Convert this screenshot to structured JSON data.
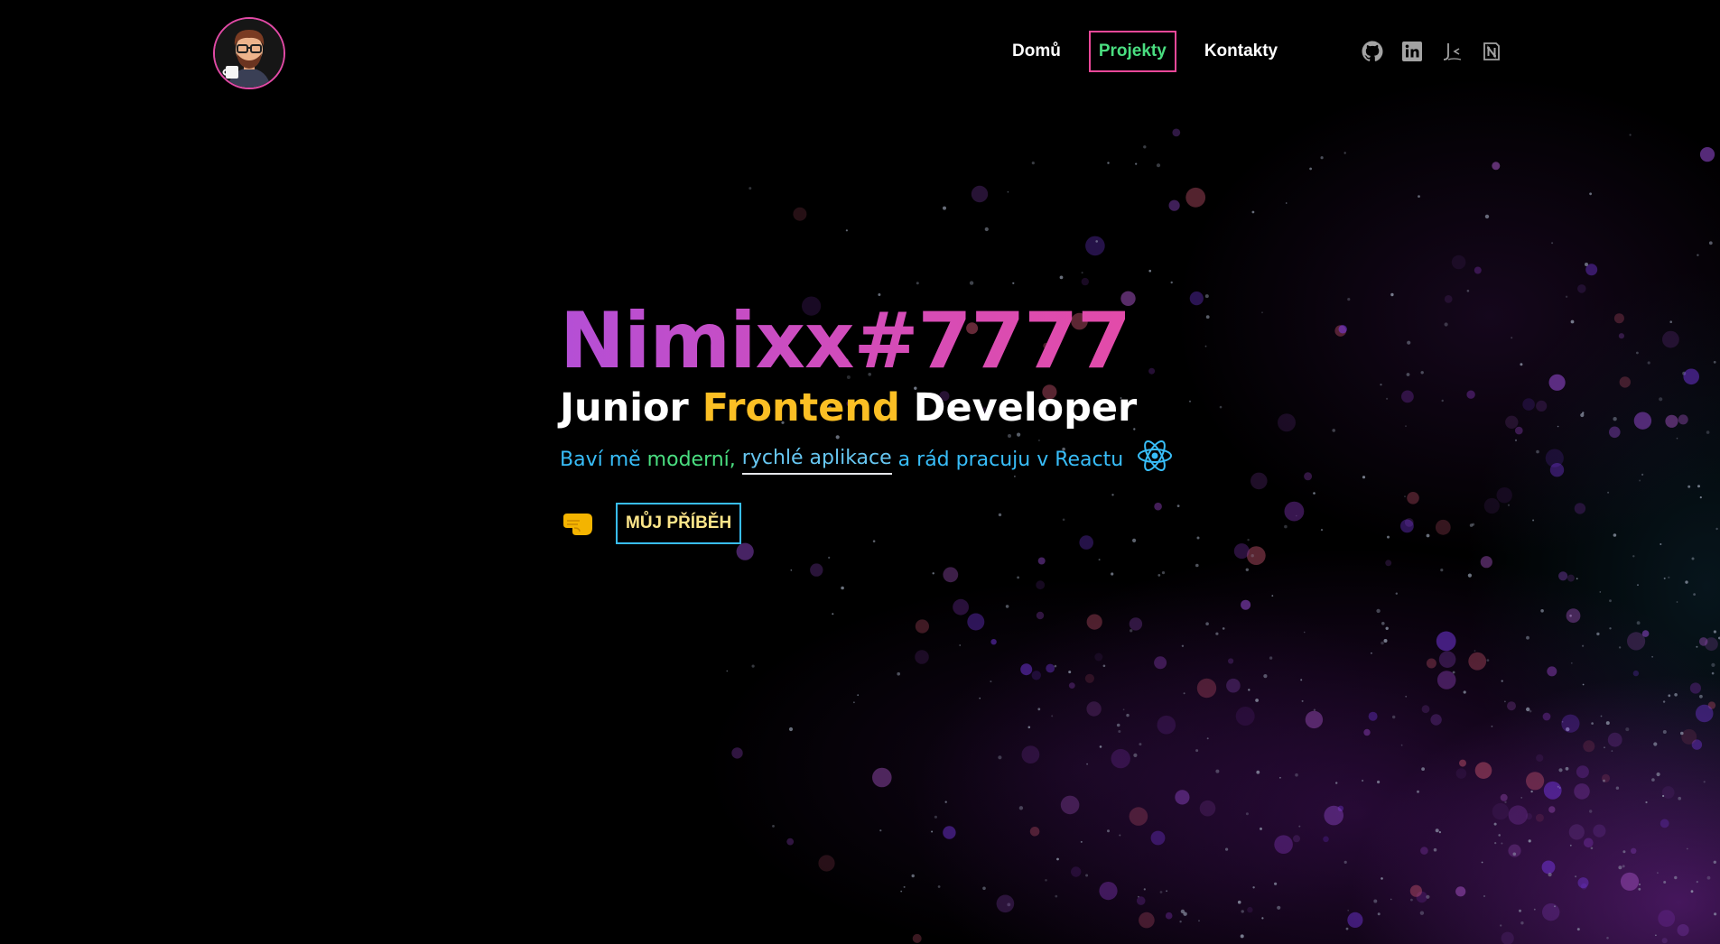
{
  "nav": {
    "avatar_alt": "avatar",
    "links": [
      {
        "label": "Domů",
        "active": false
      },
      {
        "label": "Projekty",
        "active": true
      },
      {
        "label": "Kontakty",
        "active": false
      }
    ],
    "social_icons": [
      "github-icon",
      "linkedin-icon",
      "jsfiddle-icon",
      "notion-icon"
    ]
  },
  "hero": {
    "title": "Nimixx#7777",
    "subtitle_pre": "Junior ",
    "subtitle_accent": "Frontend",
    "subtitle_post": " Developer",
    "tagline_part1": "Baví mě",
    "tagline_green": "moderní,",
    "tagline_underline": "rychlé aplikace",
    "tagline_rest": "a rád pracuju v Reactu",
    "cta_label": "MŮJ PŘÍBĚH"
  },
  "colors": {
    "title_gradient_start": "#b44fd6",
    "title_gradient_end": "#e54ba6",
    "accent_yellow": "#fbbf24",
    "accent_green": "#4ade80",
    "accent_blue": "#38bdf8",
    "active_border": "#ec4899"
  }
}
